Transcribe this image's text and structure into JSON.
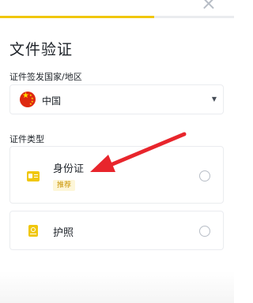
{
  "header": {
    "close_icon": "close-icon",
    "progress": 0.66
  },
  "title": "文件验证",
  "country": {
    "label": "证件签发国家/地区",
    "selected": "中国",
    "flag_icon": "china-flag-icon",
    "caret_icon": "caret-down-icon"
  },
  "doc_type": {
    "label": "证件类型",
    "options": [
      {
        "label": "身份证",
        "badge": "推荐",
        "icon": "id-card-icon"
      },
      {
        "label": "护照",
        "icon": "passport-icon"
      }
    ]
  },
  "colors": {
    "accent": "#F0C70C",
    "annotation_arrow": "#E8252C"
  }
}
